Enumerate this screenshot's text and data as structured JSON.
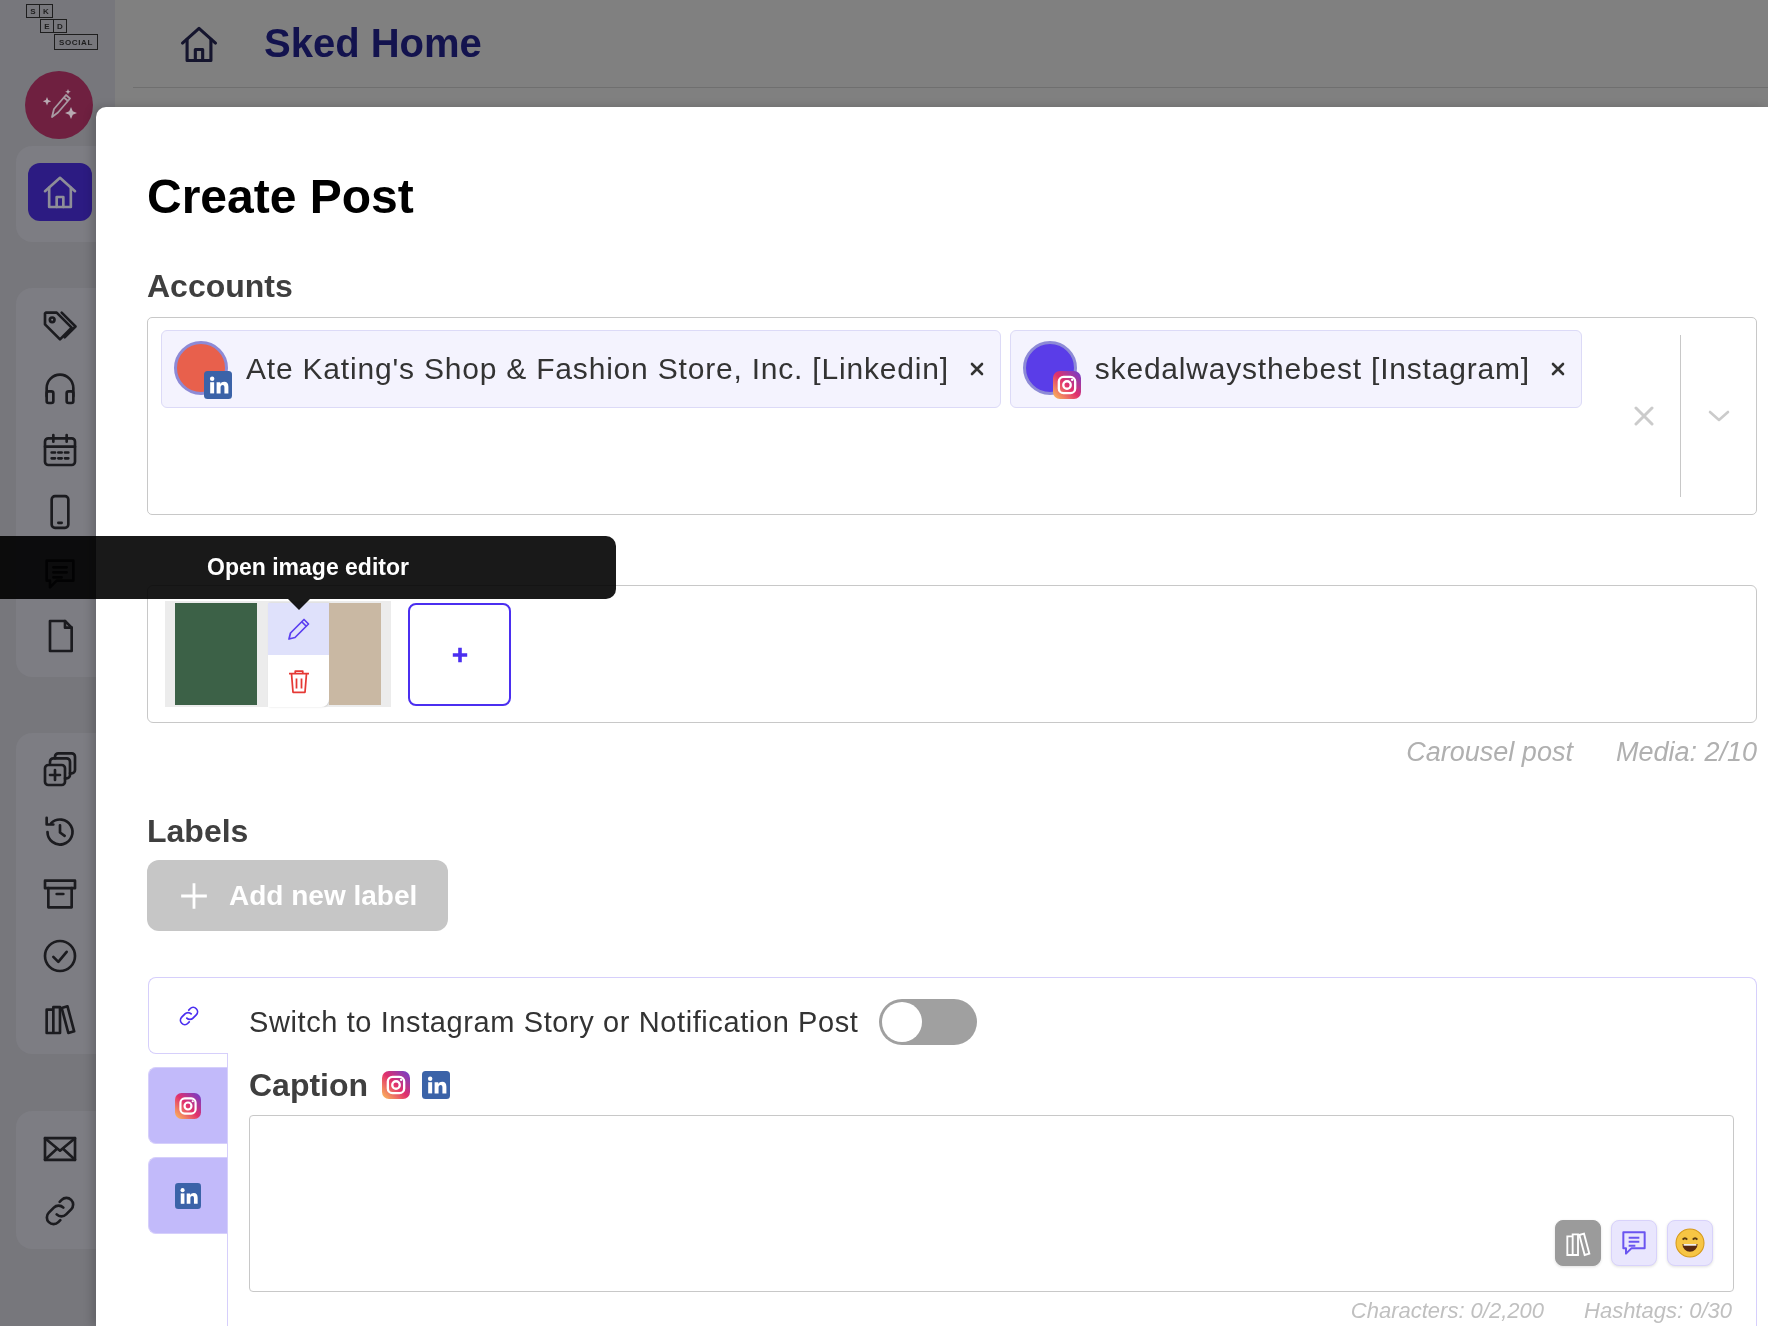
{
  "sidebar": {
    "logo": {
      "letters": [
        "S",
        "K",
        "E",
        "D"
      ],
      "word": "SOCIAL"
    },
    "groups": [
      {
        "items": [
          {
            "kind": "home",
            "selected": true
          }
        ]
      },
      {
        "items": [
          {
            "kind": "tags",
            "selected": false
          },
          {
            "kind": "headphones",
            "selected": false
          },
          {
            "kind": "calendar",
            "selected": false
          },
          {
            "kind": "phone",
            "selected": false
          },
          {
            "kind": "chat",
            "selected": false
          },
          {
            "kind": "document",
            "selected": false
          }
        ]
      },
      {
        "items": [
          {
            "kind": "add-copy",
            "selected": false
          },
          {
            "kind": "history",
            "selected": false
          },
          {
            "kind": "archive",
            "selected": false
          },
          {
            "kind": "check",
            "selected": false
          },
          {
            "kind": "library",
            "selected": false
          }
        ]
      },
      {
        "items": [
          {
            "kind": "mail",
            "selected": false
          },
          {
            "kind": "link",
            "selected": false
          }
        ]
      }
    ]
  },
  "header": {
    "title": "Sked Home"
  },
  "post_editor": {
    "title": "Create Post",
    "accounts": {
      "heading": "Accounts",
      "chips": [
        {
          "name": "Ate Kating's Shop & Fashion Store, Inc. [Linkedin]",
          "kind": "linkedin",
          "color": "#e8604c"
        },
        {
          "name": "skedalwaysthebest [Instagram]",
          "kind": "instagram",
          "color": "#5a3de8"
        }
      ]
    },
    "media": {
      "items": [
        {
          "kind": "image",
          "hover": false
        },
        {
          "kind": "image",
          "hover": true
        }
      ],
      "notes": [
        "Carousel post",
        "Media: 2/10"
      ]
    },
    "labels": {
      "heading": "Labels",
      "add_button": "Add new label"
    },
    "caption_tabs": [
      {
        "kind": "all",
        "selected": true
      },
      {
        "kind": "instagram",
        "selected": false
      },
      {
        "kind": "linkedin",
        "selected": false
      }
    ],
    "story_toggle": {
      "label": "Switch to Instagram Story or Notification Post",
      "on": false
    },
    "caption": {
      "label": "Caption",
      "platforms": [
        {
          "kind": "instagram"
        },
        {
          "kind": "linkedin"
        }
      ],
      "tools": [
        {
          "kind": "library"
        },
        {
          "kind": "comments"
        },
        {
          "kind": "emoji"
        }
      ],
      "counters": [
        "Characters: 0/2,200",
        "Hashtags: 0/30"
      ]
    }
  },
  "tooltip": {
    "text": "Open image editor"
  }
}
